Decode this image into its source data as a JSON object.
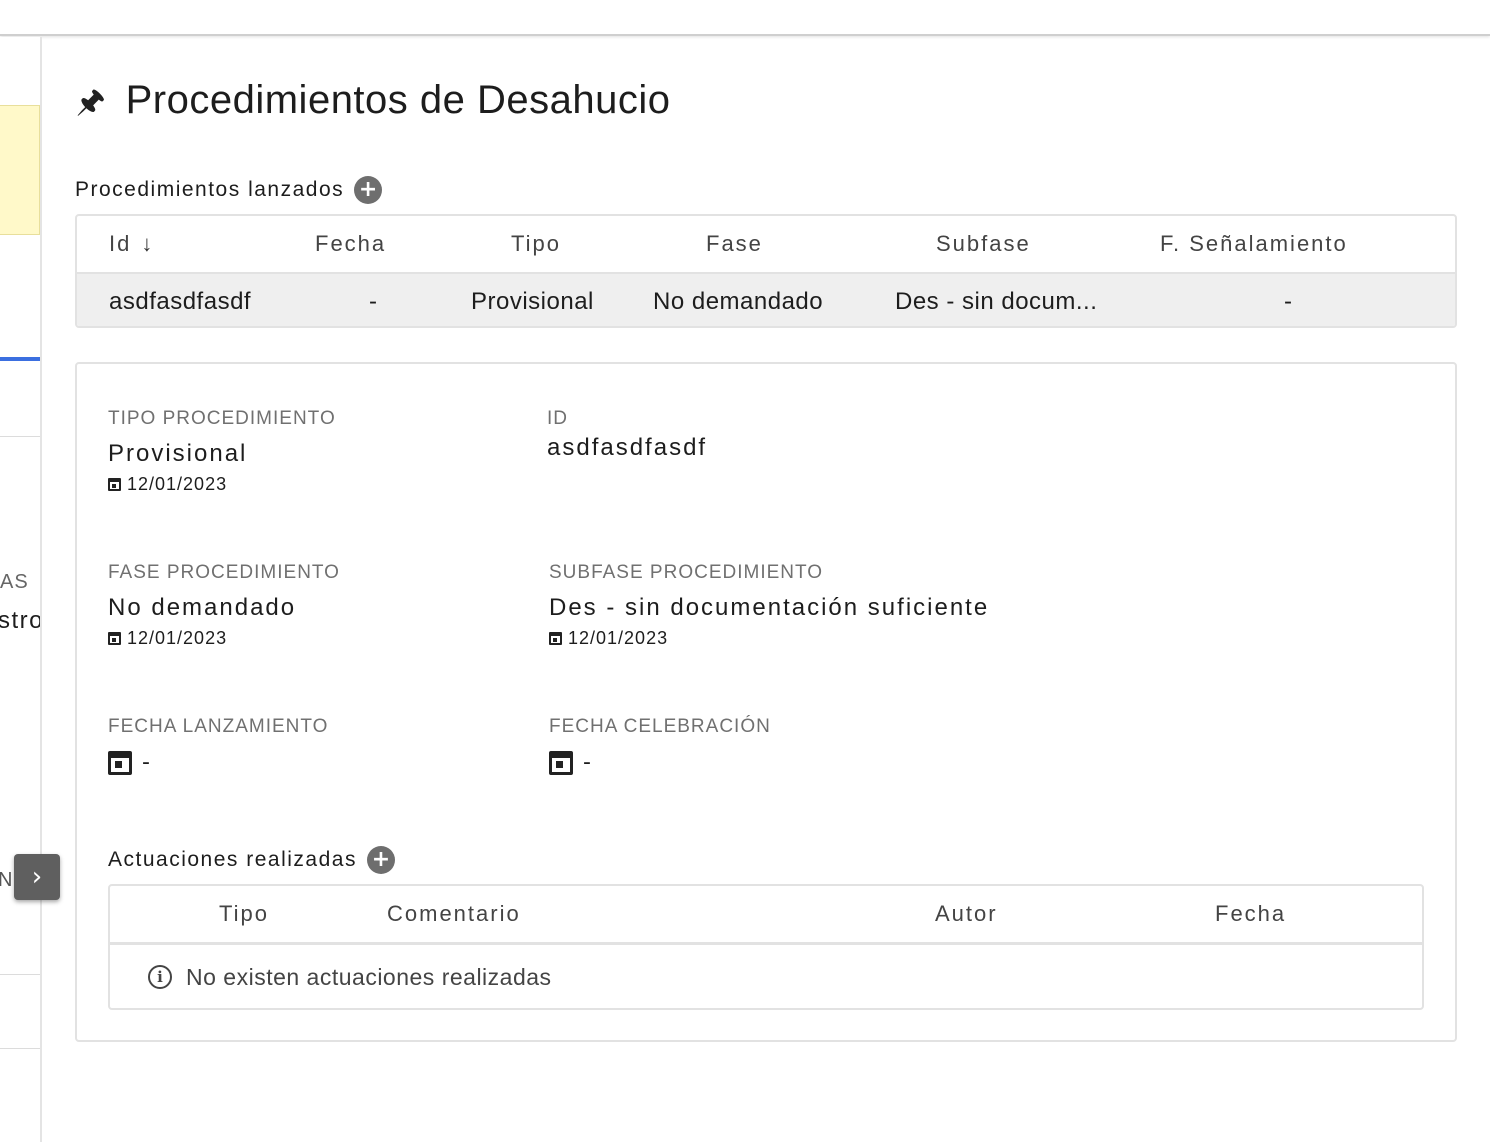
{
  "left_panel": {
    "label_fragment": "AS",
    "value_fragment": "stro",
    "side_fragment": "N",
    "collapse_icon": "chevron-right-icon",
    "collapse_glyph": "›"
  },
  "page": {
    "title": "Procedimientos de Desahucio",
    "title_icon": "pin-icon",
    "title_glyph": "🖈"
  },
  "procedimientos": {
    "section_label": "Procedimientos lanzados",
    "add_icon": "plus-circle-icon",
    "add_glyph": "+",
    "columns": [
      "Id",
      "Fecha",
      "Tipo",
      "Fase",
      "Subfase",
      "F. Señalamiento"
    ],
    "sort_glyph": "↓",
    "rows": [
      {
        "id": "asdfasdfasdf",
        "fecha": "-",
        "tipo": "Provisional",
        "fase": "No demandado",
        "subfase": "Des - sin docum...",
        "f_senalamiento": "-"
      }
    ]
  },
  "detail": {
    "tipo_procedimiento": {
      "label": "TIPO PROCEDIMIENTO",
      "value": "Provisional",
      "date": "12/01/2023"
    },
    "id": {
      "label": "ID",
      "value": "asdfasdfasdf"
    },
    "fase_procedimiento": {
      "label": "FASE PROCEDIMIENTO",
      "value": "No demandado",
      "date": "12/01/2023"
    },
    "subfase_procedimiento": {
      "label": "SUBFASE PROCEDIMIENTO",
      "value": "Des - sin documentación suficiente",
      "date": "12/01/2023"
    },
    "fecha_lanzamiento": {
      "label": "FECHA LANZAMIENTO",
      "value": "-"
    },
    "fecha_celebracion": {
      "label": "FECHA CELEBRACIÓN",
      "value": "-"
    }
  },
  "actuaciones": {
    "section_label": "Actuaciones realizadas",
    "add_glyph": "+",
    "columns": [
      "Tipo",
      "Comentario",
      "Autor",
      "Fecha"
    ],
    "empty_message": "No existen actuaciones realizadas",
    "info_glyph": "i"
  }
}
